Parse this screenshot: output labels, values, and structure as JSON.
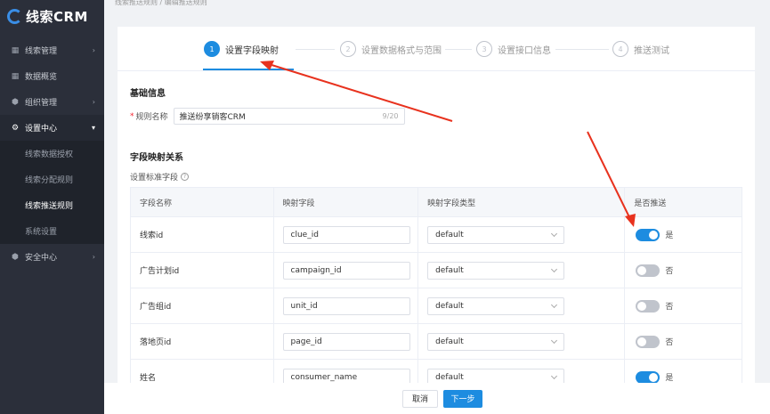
{
  "app": {
    "logo_text": "线索CRM"
  },
  "sidebar": {
    "items": [
      {
        "label": "线索管理",
        "icon": "chart-icon",
        "arrow": "›"
      },
      {
        "label": "数据概览",
        "icon": "chart-icon"
      },
      {
        "label": "组织管理",
        "icon": "shield-icon",
        "arrow": "›"
      },
      {
        "label": "设置中心",
        "icon": "gear-icon",
        "arrow": "▾"
      }
    ],
    "sub_items": [
      {
        "label": "线索数据授权"
      },
      {
        "label": "线索分配规则"
      },
      {
        "label": "线索推送规则"
      },
      {
        "label": "系统设置"
      }
    ],
    "bottom_item": {
      "label": "安全中心",
      "icon": "shield-icon",
      "arrow": "›"
    }
  },
  "breadcrumb": {
    "text": "线索推送规则 / 编辑推送规则"
  },
  "steps": [
    {
      "num": "1",
      "label": "设置字段映射"
    },
    {
      "num": "2",
      "label": "设置数据格式与范围"
    },
    {
      "num": "3",
      "label": "设置接口信息"
    },
    {
      "num": "4",
      "label": "推送测试"
    }
  ],
  "basic_info": {
    "title": "基础信息",
    "rule_name_label": "规则名称",
    "rule_name_value": "推送纷享销客CRM",
    "rule_name_count": "9/20"
  },
  "mapping": {
    "title": "字段映射关系",
    "caption": "设置标准字段",
    "headers": [
      "字段名称",
      "映射字段",
      "映射字段类型",
      "是否推送"
    ],
    "rows": [
      {
        "name": "线索id",
        "field": "clue_id",
        "type": "default",
        "push": true,
        "push_text": "是"
      },
      {
        "name": "广告计划id",
        "field": "campaign_id",
        "type": "default",
        "push": false,
        "push_text": "否"
      },
      {
        "name": "广告组id",
        "field": "unit_id",
        "type": "default",
        "push": false,
        "push_text": "否"
      },
      {
        "name": "落地页id",
        "field": "page_id",
        "type": "default",
        "push": false,
        "push_text": "否"
      },
      {
        "name": "姓名",
        "field": "consumer_name",
        "type": "default",
        "push": true,
        "push_text": "是"
      }
    ]
  },
  "footer": {
    "cancel_label": "取消",
    "next_label": "下一步"
  },
  "colors": {
    "accent": "#1d8ce0",
    "sidebar_bg": "#2b2f3a",
    "annotation": "#e8321e"
  }
}
